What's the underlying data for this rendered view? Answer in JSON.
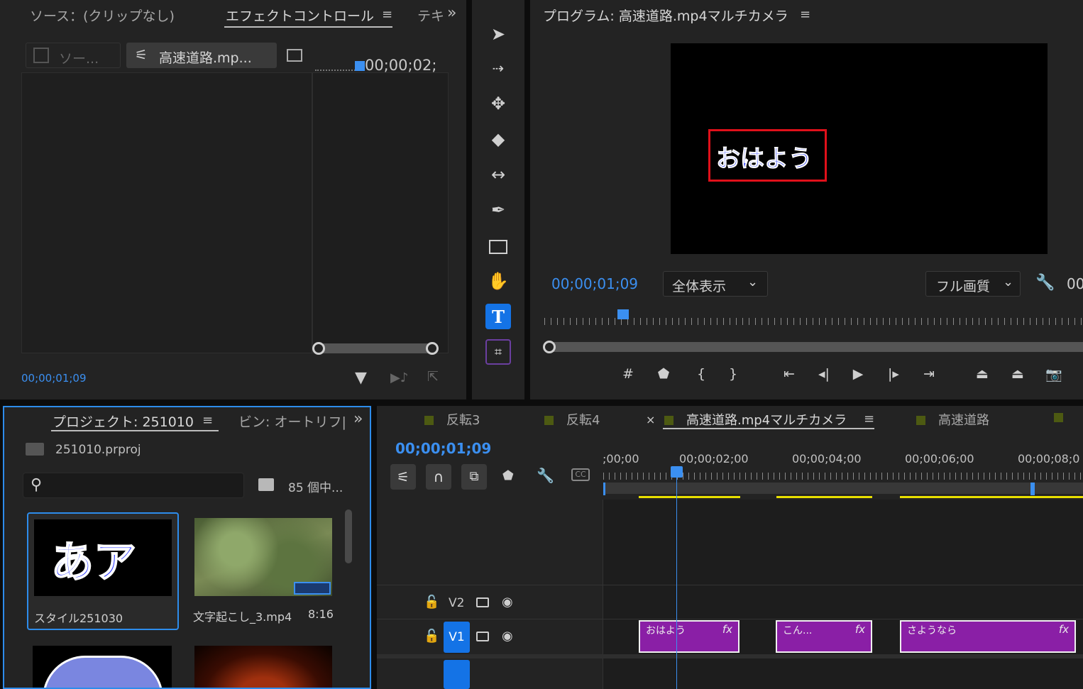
{
  "source_panel": {
    "tab_source": "ソース：(クリップなし)",
    "tab_effect_controls": "エフェクトコントロール",
    "tab_text": "テキ",
    "menu": "≡",
    "overflow": "»",
    "subtab_source": "ソー...",
    "subtab_clip": "高速道路.mp...",
    "mini_timecode": "00;00;02;",
    "timecode": "00;00;01;09"
  },
  "tools": {
    "items": [
      "selection",
      "track-select-forward",
      "ripple-edit",
      "razor",
      "slip",
      "pen",
      "rectangle",
      "hand",
      "type",
      "remix"
    ],
    "type_label": "T",
    "active_color": "#1473e6"
  },
  "program_monitor": {
    "title": "プログラム: 高速道路.mp4マルチカメラ",
    "menu": "≡",
    "overlay_text": "おはよう",
    "timecode": "00;00;01;09",
    "zoom": "全体表示",
    "quality": "フル画質",
    "right_timecode_partial": "00",
    "highlight_color": "#e0101a"
  },
  "project_panel": {
    "title": "プロジェクト: 251010",
    "menu": "≡",
    "bin_tab": "ビン: オートリフ|",
    "overflow": "»",
    "file_name": "251010.prproj",
    "search_placeholder": "",
    "item_count": "85 個中...",
    "items": [
      {
        "name": "スタイル251030",
        "duration": "",
        "thumb_text": "あア"
      },
      {
        "name": "文字起こし_3.mp4",
        "duration": "8:16",
        "thumb_text": ""
      }
    ]
  },
  "timeline": {
    "tabs": [
      {
        "label": "反転3"
      },
      {
        "label": "反転4"
      },
      {
        "label": "高速道路.mp4マルチカメラ",
        "close": "×",
        "menu": "≡"
      },
      {
        "label": "高速道路"
      }
    ],
    "timecode": "00;00;01;09",
    "ruler": [
      ";00;00",
      "00;00;02;00",
      "00;00;04;00",
      "00;00;06;00",
      "00;00;08;0"
    ],
    "tracks": [
      {
        "name": "V2"
      },
      {
        "name": "V1"
      }
    ],
    "clips": [
      {
        "label": "おはよう",
        "fx": "fx"
      },
      {
        "label": "こん...",
        "fx": "fx"
      },
      {
        "label": "さようなら",
        "fx": "fx"
      }
    ],
    "clip_color": "#8a1fa6",
    "render_bar_color": "#e8e000"
  }
}
